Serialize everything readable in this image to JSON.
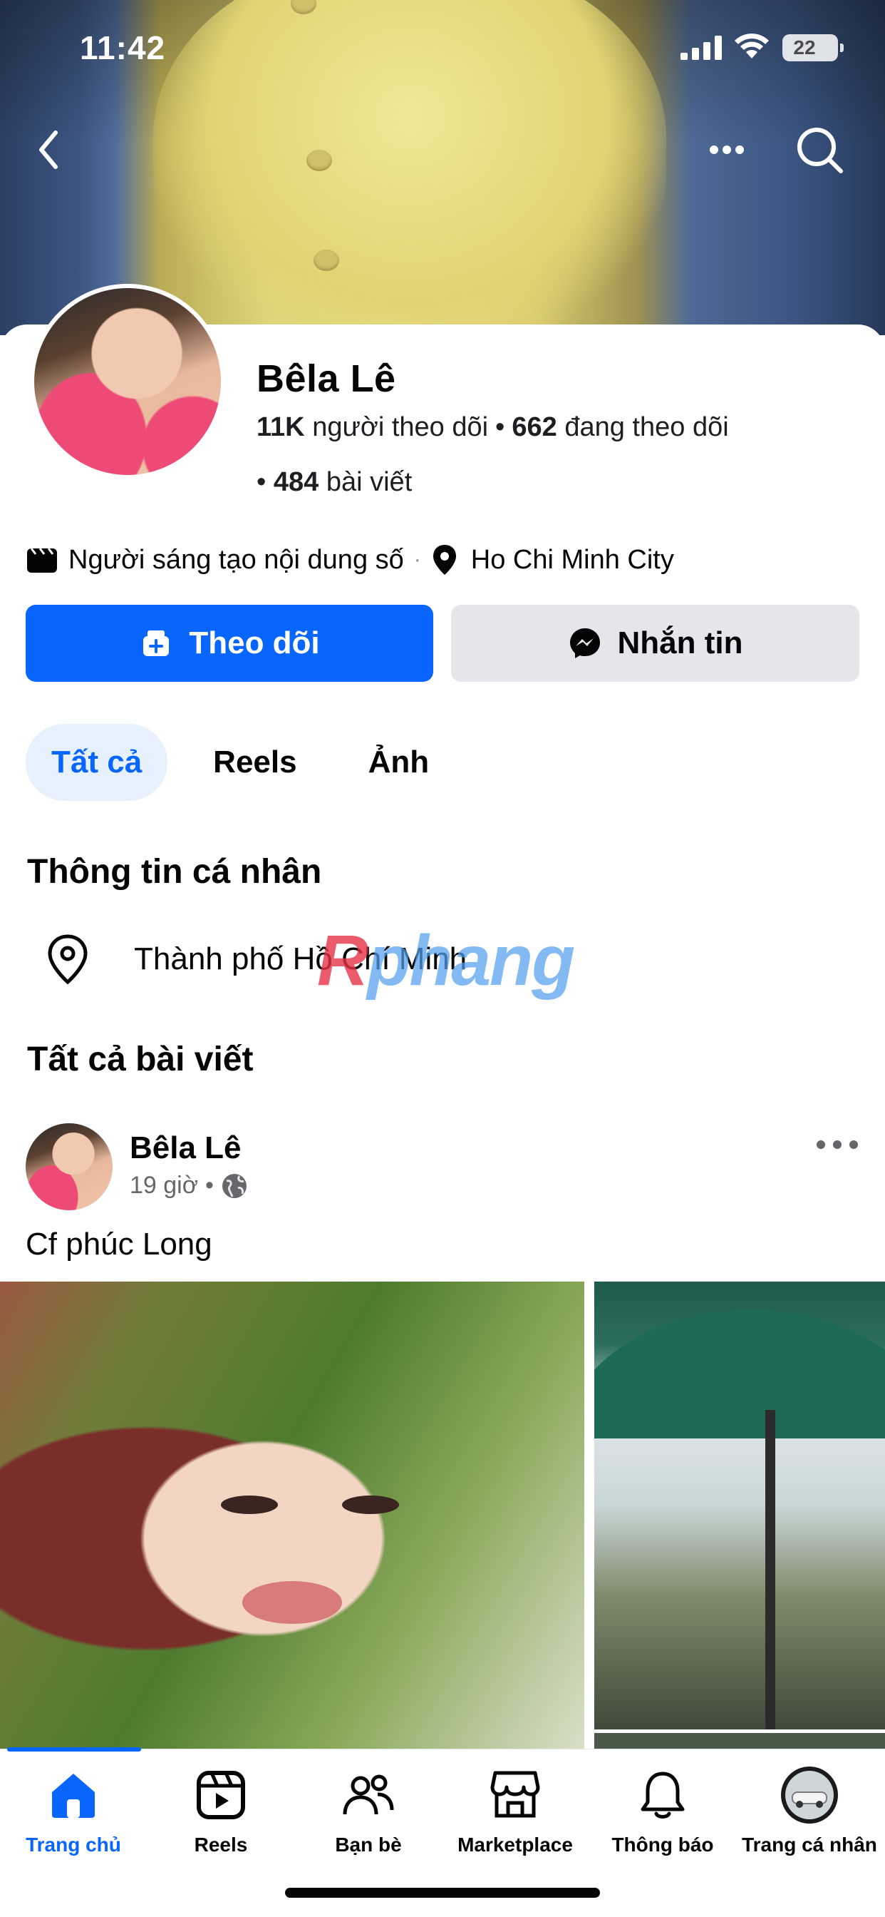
{
  "status_bar": {
    "time": "11:42",
    "battery": "22"
  },
  "profile": {
    "name": "Bêla Lê",
    "followers_count": "11K",
    "followers_label": "người theo dõi",
    "following_count": "662",
    "following_label": "đang theo dõi",
    "posts_count": "484",
    "posts_label": "bài viết",
    "category": "Người sáng tạo nội dung số",
    "location": "Ho Chi Minh City"
  },
  "actions": {
    "follow_label": "Theo dõi",
    "message_label": "Nhắn tin"
  },
  "tabs": [
    {
      "label": "Tất cả",
      "active": true
    },
    {
      "label": "Reels",
      "active": false
    },
    {
      "label": "Ảnh",
      "active": false
    }
  ],
  "personal_info": {
    "title": "Thông tin cá nhân",
    "city": "Thành phố Hồ Chí Minh"
  },
  "watermark": {
    "first": "R",
    "rest": "phang"
  },
  "all_posts": {
    "title": "Tất cả bài viết"
  },
  "post": {
    "author": "Bêla Lê",
    "time": "19 giờ",
    "text": "Cf phúc Long"
  },
  "bottom_nav": [
    {
      "label": "Trang chủ",
      "icon": "home-icon",
      "active": true
    },
    {
      "label": "Reels",
      "icon": "reels-icon",
      "active": false
    },
    {
      "label": "Bạn bè",
      "icon": "friends-icon",
      "active": false
    },
    {
      "label": "Marketplace",
      "icon": "marketplace-icon",
      "active": false
    },
    {
      "label": "Thông báo",
      "icon": "bell-icon",
      "active": false
    },
    {
      "label": "Trang cá nhân",
      "icon": "profile-avatar-icon",
      "active": false
    }
  ],
  "colors": {
    "primary": "#0866ff",
    "secondary_button": "#e4e6eb",
    "tab_active_bg": "#e7f0fd",
    "text": "#050505",
    "muted": "#65676b"
  }
}
